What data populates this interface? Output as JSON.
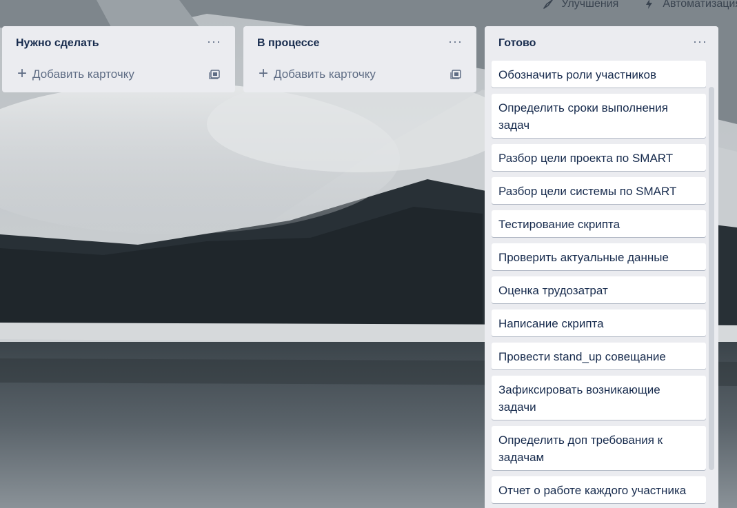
{
  "header": {
    "actions": [
      {
        "label": "Улучшения",
        "icon": "rocket-icon"
      },
      {
        "label": "Автоматизация",
        "icon": "automation-icon"
      }
    ]
  },
  "lists": [
    {
      "title": "Нужно сделать",
      "add_label": "Добавить карточку"
    },
    {
      "title": "В процессе",
      "add_label": "Добавить карточку"
    },
    {
      "title": "Готово",
      "cards": [
        "Обозначить роли участников",
        "Определить сроки выполнения задач",
        "Разбор цели проекта по SMART",
        "Разбор цели системы по SMART",
        "Тестирование скрипта",
        "Проверить актуальные данные",
        "Оценка трудозатрат",
        "Написание скрипта",
        "Провести stand_up совещание",
        "Зафиксировать возникающие задачи",
        "Определить доп требования к задачам",
        "Отчет о работе каждого участника"
      ]
    }
  ],
  "colors": {
    "list_bg": "#ebecf0",
    "card_bg": "#ffffff",
    "text": "#172b4d",
    "muted": "#5e6c84"
  }
}
